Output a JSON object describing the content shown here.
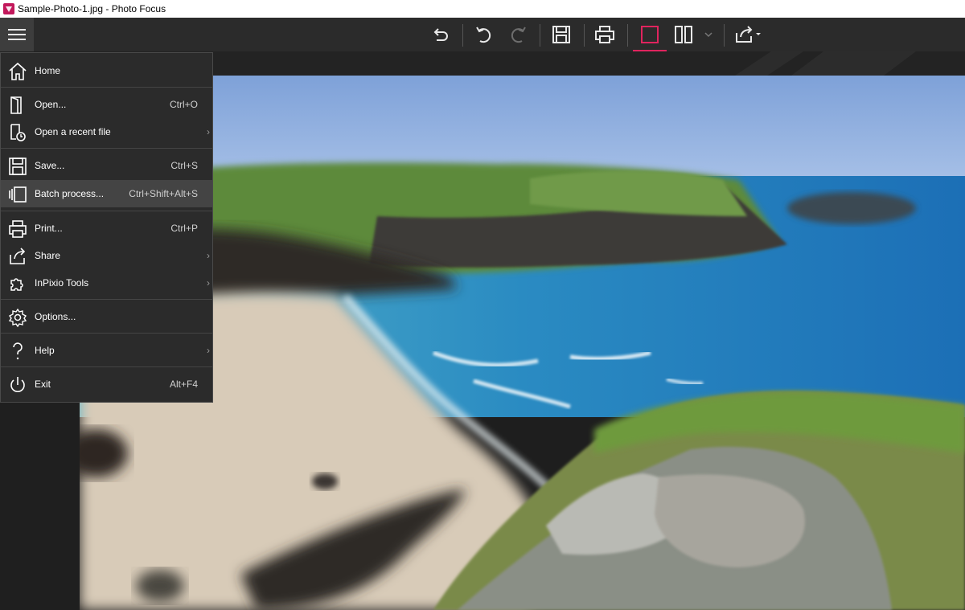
{
  "window": {
    "title": "Sample-Photo-1.jpg - Photo Focus"
  },
  "colors": {
    "accent": "#e0245e",
    "menu_bg": "#2b2b2b",
    "toolbar_bg": "#2b2b2b"
  },
  "toolbar": {
    "buttons": [
      "menu-icon",
      "undo-history-icon",
      "undo-icon",
      "redo-icon",
      "save-icon",
      "print-icon",
      "compare-single-icon",
      "compare-split-icon",
      "chevron-down-icon",
      "share-icon"
    ]
  },
  "menu": {
    "items": [
      {
        "label": "Home",
        "shortcut": "",
        "icon": "home-icon"
      },
      {
        "label": "Open...",
        "shortcut": "Ctrl+O",
        "icon": "open-icon"
      },
      {
        "label": "Open a recent file",
        "shortcut": "",
        "arrow": "›",
        "icon": "recent-file-icon"
      },
      {
        "label": "Save...",
        "shortcut": "Ctrl+S",
        "icon": "save-icon"
      },
      {
        "label": "Batch process...",
        "shortcut": "Ctrl+Shift+Alt+S",
        "icon": "batch-icon"
      },
      {
        "label": "Print...",
        "shortcut": "Ctrl+P",
        "icon": "print-icon"
      },
      {
        "label": "Share",
        "shortcut": "",
        "arrow": "›",
        "icon": "share-icon"
      },
      {
        "label": "InPixio Tools",
        "shortcut": "",
        "arrow": "›",
        "icon": "puzzle-icon"
      },
      {
        "label": "Options...",
        "shortcut": "",
        "icon": "gear-icon"
      },
      {
        "label": "Help",
        "shortcut": "",
        "arrow": "›",
        "icon": "help-icon"
      },
      {
        "label": "Exit",
        "shortcut": "Alt+F4",
        "icon": "power-icon"
      }
    ]
  }
}
